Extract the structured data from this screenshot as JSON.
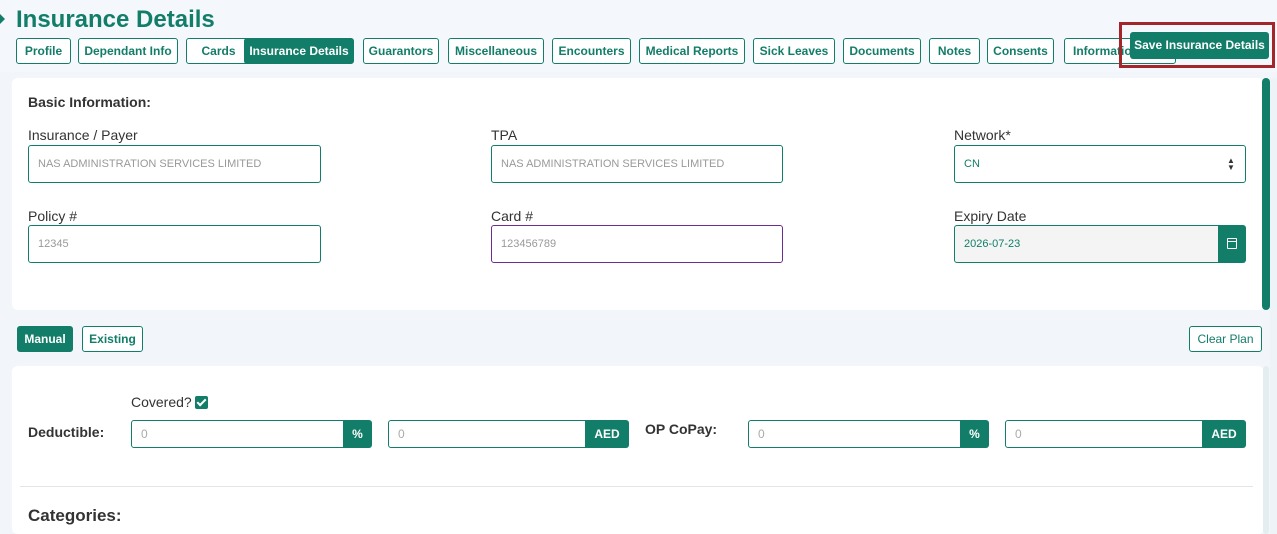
{
  "header": {
    "title": "Insurance Details",
    "save_label": "Save Insurance Details"
  },
  "tabs": [
    {
      "label": "Profile"
    },
    {
      "label": "Dependant Info"
    },
    {
      "label": "Cards"
    },
    {
      "label": "Insurance Details",
      "active": true
    },
    {
      "label": "Guarantors"
    },
    {
      "label": "Miscellaneous"
    },
    {
      "label": "Encounters"
    },
    {
      "label": "Medical Reports"
    },
    {
      "label": "Sick Leaves"
    },
    {
      "label": "Documents"
    },
    {
      "label": "Notes"
    },
    {
      "label": "Consents"
    },
    {
      "label": "Informatio"
    }
  ],
  "basic_info": {
    "title": "Basic Information:",
    "insurance_label": "Insurance / Payer",
    "insurance_value": "NAS ADMINISTRATION SERVICES LIMITED",
    "tpa_label": "TPA",
    "tpa_value": "NAS ADMINISTRATION SERVICES LIMITED",
    "network_label": "Network*",
    "network_value": "CN",
    "policy_label": "Policy #",
    "policy_value": "12345",
    "card_label": "Card #",
    "card_value": "123456789",
    "expiry_label": "Expiry Date",
    "expiry_value": "2026-07-23"
  },
  "plan": {
    "manual_label": "Manual",
    "existing_label": "Existing",
    "clear_label": "Clear Plan"
  },
  "coverage": {
    "covered_label": "Covered?",
    "covered_checked": true,
    "deductible_label": "Deductible:",
    "deductible_percent": "0",
    "deductible_amount": "0",
    "opcopay_label": "OP CoPay:",
    "opcopay_percent": "0",
    "opcopay_amount": "0",
    "percent_symbol": "%",
    "currency": "AED",
    "categories_title": "Categories:"
  },
  "colors": {
    "accent": "#127d68",
    "highlight": "#a3262b"
  }
}
